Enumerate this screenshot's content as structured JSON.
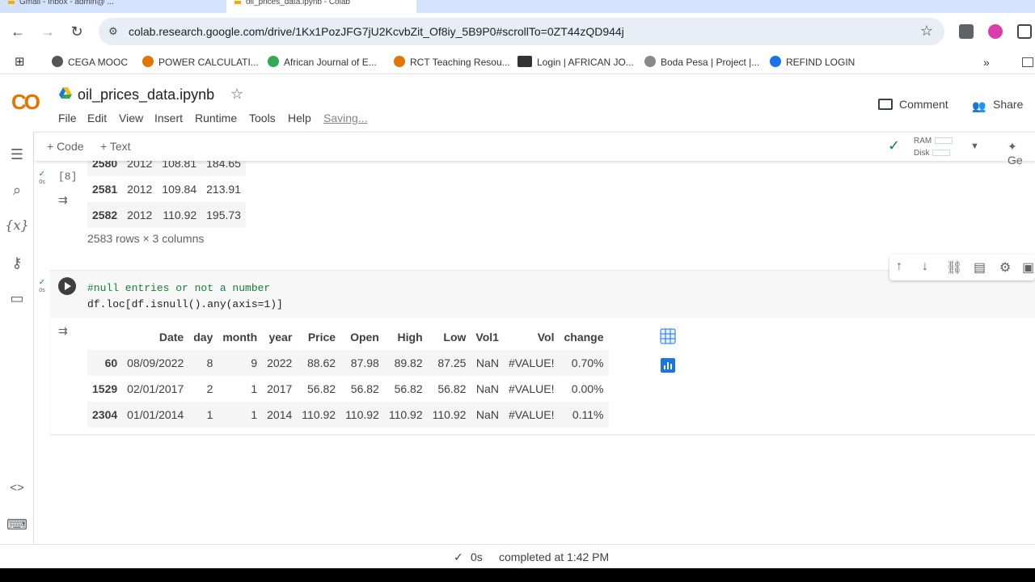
{
  "browser": {
    "tabs": [
      {
        "label": "Gmail - Inbox - admin@ ..."
      },
      {
        "label": "oil_prices_data.ipynb - Colab"
      }
    ],
    "url": "colab.research.google.com/drive/1Kx1PozJFG7jU2KcvbZit_Of8iy_5B9P0#scrollTo=0ZT44zQD944j",
    "bookmarks": [
      {
        "label": "CEGA MOOC"
      },
      {
        "label": "POWER CALCULATI..."
      },
      {
        "label": "African Journal of E..."
      },
      {
        "label": "RCT Teaching Resou..."
      },
      {
        "label": "Login | AFRICAN JO..."
      },
      {
        "label": "Boda Pesa | Project |..."
      },
      {
        "label": "REFIND LOGIN"
      }
    ]
  },
  "colab": {
    "logo": "CO",
    "notebook_title": "oil_prices_data.ipynb",
    "menu": [
      "File",
      "Edit",
      "View",
      "Insert",
      "Runtime",
      "Tools",
      "Help"
    ],
    "saving_label": "Saving...",
    "comment_label": "Comment",
    "share_label": "Share",
    "toolbar": {
      "add_code": "+ Code",
      "add_text": "+ Text",
      "ram_label": "RAM",
      "disk_label": "Disk",
      "gemini_label": "Ge"
    }
  },
  "cell1": {
    "exec_count": "[8]",
    "status_time": "0s",
    "rows": [
      {
        "idx": "2580",
        "year": "2012",
        "price": "108.81",
        "vol": "184.65"
      },
      {
        "idx": "2581",
        "year": "2012",
        "price": "109.84",
        "vol": "213.91"
      },
      {
        "idx": "2582",
        "year": "2012",
        "price": "110.92",
        "vol": "195.73"
      }
    ],
    "row_count": "2583 rows × 3 columns"
  },
  "cell2": {
    "status_time": "0s",
    "code_comment": "#null entries or not a number",
    "code_line": "df.loc[df.isnull().any(axis=1)]",
    "columns": [
      "Date",
      "day",
      "month",
      "year",
      "Price",
      "Open",
      "High",
      "Low",
      "Vol1",
      "Vol",
      "change"
    ],
    "rows": [
      {
        "idx": "60",
        "Date": "08/09/2022",
        "day": "8",
        "month": "9",
        "year": "2022",
        "Price": "88.62",
        "Open": "87.98",
        "High": "89.82",
        "Low": "87.25",
        "Vol1": "NaN",
        "Vol": "#VALUE!",
        "change": "0.70%"
      },
      {
        "idx": "1529",
        "Date": "02/01/2017",
        "day": "2",
        "month": "1",
        "year": "2017",
        "Price": "56.82",
        "Open": "56.82",
        "High": "56.82",
        "Low": "56.82",
        "Vol1": "NaN",
        "Vol": "#VALUE!",
        "change": "0.00%"
      },
      {
        "idx": "2304",
        "Date": "01/01/2014",
        "day": "1",
        "month": "1",
        "year": "2014",
        "Price": "110.92",
        "Open": "110.92",
        "High": "110.92",
        "Low": "110.92",
        "Vol1": "NaN",
        "Vol": "#VALUE!",
        "change": "0.11%"
      }
    ]
  },
  "statusbar": {
    "time": "0s",
    "completed": "completed at 1:42 PM"
  },
  "colors": {
    "accent_blue": "#1a73e8",
    "success_green": "#188038",
    "logo_orange": "#f9ab00"
  }
}
